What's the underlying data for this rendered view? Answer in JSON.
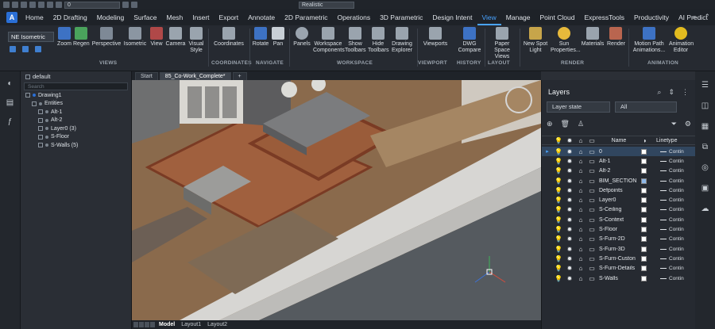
{
  "quick_access": {
    "layer_value": "0",
    "visual_style": "Realistic"
  },
  "menu": {
    "logo": "A",
    "tabs": [
      "Home",
      "2D Drafting",
      "Modeling",
      "Surface",
      "Mesh",
      "Insert",
      "Export",
      "Annotate",
      "2D Parametric",
      "Operations",
      "3D Parametric",
      "Design Intent",
      "View",
      "Manage",
      "Point Cloud",
      "ExpressTools",
      "Productivity",
      "AI Predict"
    ],
    "active_tab": "View"
  },
  "ribbon": {
    "view_select": "NE Isometric",
    "buttons": [
      {
        "label": "Zoom",
        "icon": "zoom-icon"
      },
      {
        "label": "Regen",
        "icon": "regen-icon"
      },
      {
        "label": "Perspective",
        "icon": "perspective-icon"
      },
      {
        "label": "Isometric",
        "icon": "isometric-icon"
      },
      {
        "label": "View",
        "icon": "view-icon"
      },
      {
        "label": "Camera",
        "icon": "camera-icon"
      },
      {
        "label": "Visual Style",
        "icon": "visual-style-icon"
      },
      {
        "label": "Coordinates",
        "icon": "coordinates-icon"
      },
      {
        "label": "Rotate",
        "icon": "rotate-icon"
      },
      {
        "label": "Pan",
        "icon": "pan-icon"
      },
      {
        "label": "Panels",
        "icon": "panels-icon"
      },
      {
        "label": "Workspace Components",
        "icon": "workspace-icon"
      },
      {
        "label": "Show Toolbars",
        "icon": "show-toolbars-icon"
      },
      {
        "label": "Hide Toolbars",
        "icon": "hide-toolbars-icon"
      },
      {
        "label": "Drawing Explorer",
        "icon": "drawing-explorer-icon"
      },
      {
        "label": "Viewports",
        "icon": "viewports-icon"
      },
      {
        "label": "DWG Compare",
        "icon": "dwg-compare-icon"
      },
      {
        "label": "Paper Space Views",
        "icon": "paper-space-icon"
      },
      {
        "label": "New Spot Light",
        "icon": "spot-light-icon"
      },
      {
        "label": "Sun Properties...",
        "icon": "sun-icon"
      },
      {
        "label": "Materials",
        "icon": "materials-icon"
      },
      {
        "label": "Render",
        "icon": "render-icon"
      },
      {
        "label": "Motion Path Animations...",
        "icon": "motion-path-icon"
      },
      {
        "label": "Animation Editor",
        "icon": "animation-editor-icon"
      }
    ],
    "groups": [
      "VIEWS",
      "COORDINATES",
      "NAVIGATE",
      "WORKSPACE",
      "VIEWPORT",
      "HISTORY",
      "LAYOUT",
      "RENDER",
      "ANIMATION"
    ]
  },
  "explorer": {
    "title": "default",
    "search_placeholder": "Search",
    "tree": [
      {
        "label": "Drawing1",
        "level": 0
      },
      {
        "label": "Entities",
        "level": 1
      },
      {
        "label": "Alt-1",
        "level": 2
      },
      {
        "label": "Alt-2",
        "level": 2
      },
      {
        "label": "Layer0 (3)",
        "level": 2
      },
      {
        "label": "S-Floor",
        "level": 2
      },
      {
        "label": "S-Walls (5)",
        "level": 2
      }
    ]
  },
  "doc_tabs": [
    "Start",
    "85_Co-Work_Complete*",
    "+"
  ],
  "layout_tabs": [
    "Model",
    "Layout1",
    "Layout2"
  ],
  "layers_panel": {
    "title": "Layers",
    "state_placeholder": "Layer state",
    "filter": "All",
    "columns": {
      "name": "Name",
      "linetype": "Linetype"
    },
    "layers": [
      {
        "name": "0",
        "color": "#ffffff",
        "linetype": "Contin"
      },
      {
        "name": "Alt-1",
        "color": "#ffffff",
        "linetype": "Contin"
      },
      {
        "name": "Alt-2",
        "color": "#ffffff",
        "linetype": "Contin"
      },
      {
        "name": "BIM_SECTION",
        "color": "#8fb8e8",
        "linetype": "Contin"
      },
      {
        "name": "Defpoints",
        "color": "#ffffff",
        "linetype": "Contin"
      },
      {
        "name": "Layer0",
        "color": "#ffffff",
        "linetype": "Contin"
      },
      {
        "name": "S-Ceiling",
        "color": "#ffffff",
        "linetype": "Contin"
      },
      {
        "name": "S-Context",
        "color": "#ffffff",
        "linetype": "Contin"
      },
      {
        "name": "S-Floor",
        "color": "#ffffff",
        "linetype": "Contin"
      },
      {
        "name": "S-Furn-2D",
        "color": "#ffffff",
        "linetype": "Contin"
      },
      {
        "name": "S-Furn-3D",
        "color": "#ffffff",
        "linetype": "Contin"
      },
      {
        "name": "S-Furn-Custon",
        "color": "#ffffff",
        "linetype": "Contin"
      },
      {
        "name": "S-Furn-Details",
        "color": "#ffffff",
        "linetype": "Contin"
      },
      {
        "name": "S-Walls",
        "color": "#ffffff",
        "linetype": "Contin"
      }
    ]
  }
}
